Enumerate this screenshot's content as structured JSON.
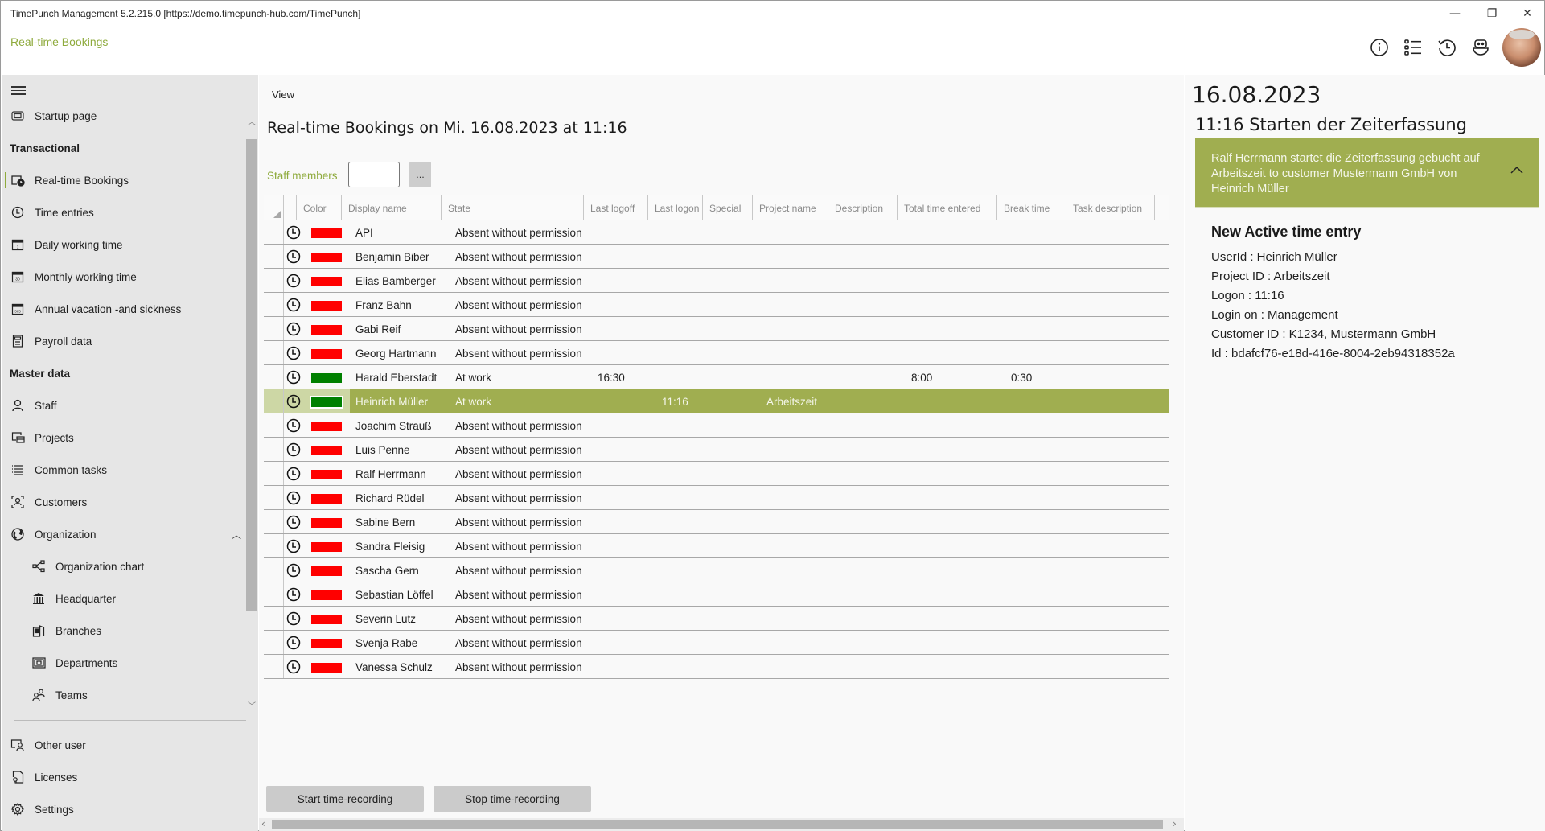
{
  "window": {
    "title": "TimePunch Management 5.2.215.0 [https://demo.timepunch-hub.com/TimePunch]",
    "controls": {
      "minimize": "—",
      "restore": "❐",
      "close": "✕"
    }
  },
  "header": {
    "breadcrumb": "Real-time Bookings",
    "icons": [
      "info-icon",
      "list-icon",
      "history-icon",
      "bot-icon"
    ],
    "avatar": "user-avatar"
  },
  "sidebar": {
    "items": [
      {
        "id": "startup",
        "label": "Startup page",
        "icon": "startup-icon"
      },
      {
        "id": "section-transactional",
        "label": "Transactional",
        "section": true
      },
      {
        "id": "realtime",
        "label": "Real-time Bookings",
        "icon": "realtime-icon",
        "active": true
      },
      {
        "id": "time-entries",
        "label": "Time entries",
        "icon": "clock-icon"
      },
      {
        "id": "daily",
        "label": "Daily working time",
        "icon": "calendar-day-icon"
      },
      {
        "id": "monthly",
        "label": "Monthly working time",
        "icon": "calendar-month-icon"
      },
      {
        "id": "annual",
        "label": "Annual vacation -and sickness",
        "icon": "calendar-year-icon"
      },
      {
        "id": "payroll",
        "label": "Payroll data",
        "icon": "calculator-icon"
      },
      {
        "id": "section-master",
        "label": "Master data",
        "section": true
      },
      {
        "id": "staff",
        "label": "Staff",
        "icon": "person-icon"
      },
      {
        "id": "projects",
        "label": "Projects",
        "icon": "projects-icon"
      },
      {
        "id": "tasks",
        "label": "Common tasks",
        "icon": "list-icon"
      },
      {
        "id": "customers",
        "label": "Customers",
        "icon": "customer-icon"
      },
      {
        "id": "organization",
        "label": "Organization",
        "icon": "globe-icon",
        "expanded": true
      },
      {
        "id": "orgchart",
        "label": "Organization chart",
        "icon": "orgchart-icon",
        "sub": true
      },
      {
        "id": "hq",
        "label": "Headquarter",
        "icon": "bank-icon",
        "sub": true
      },
      {
        "id": "branches",
        "label": "Branches",
        "icon": "building-icon",
        "sub": true
      },
      {
        "id": "departments",
        "label": "Departments",
        "icon": "department-icon",
        "sub": true
      },
      {
        "id": "teams",
        "label": "Teams",
        "icon": "team-icon",
        "sub": true
      }
    ],
    "footer": [
      {
        "id": "other-user",
        "label": "Other user",
        "icon": "switch-user-icon"
      },
      {
        "id": "licenses",
        "label": "Licenses",
        "icon": "license-icon"
      },
      {
        "id": "settings",
        "label": "Settings",
        "icon": "gear-icon"
      }
    ]
  },
  "main": {
    "view_label": "View",
    "title": "Real-time Bookings on Mi. 16.08.2023 at 11:16",
    "filter": {
      "label": "Staff members",
      "value": "",
      "browse_label": "..."
    },
    "columns": [
      "Color",
      "Display name",
      "State",
      "Last logoff",
      "Last logon",
      "Special",
      "Project name",
      "Description",
      "Total time entered",
      "Break time",
      "Task description"
    ],
    "status_colors": {
      "absent": "#ff0000",
      "at_work": "#008000"
    },
    "rows": [
      {
        "color": "absent",
        "name": "API",
        "state": "Absent without permission",
        "last_logoff": "",
        "last_logon": "",
        "special": "",
        "project": "",
        "description": "",
        "total": "",
        "break": "",
        "task": ""
      },
      {
        "color": "absent",
        "name": "Benjamin Biber",
        "state": "Absent without permission",
        "last_logoff": "",
        "last_logon": "",
        "special": "",
        "project": "",
        "description": "",
        "total": "",
        "break": "",
        "task": ""
      },
      {
        "color": "absent",
        "name": "Elias Bamberger",
        "state": "Absent without permission",
        "last_logoff": "",
        "last_logon": "",
        "special": "",
        "project": "",
        "description": "",
        "total": "",
        "break": "",
        "task": ""
      },
      {
        "color": "absent",
        "name": "Franz Bahn",
        "state": "Absent without permission",
        "last_logoff": "",
        "last_logon": "",
        "special": "",
        "project": "",
        "description": "",
        "total": "",
        "break": "",
        "task": ""
      },
      {
        "color": "absent",
        "name": "Gabi Reif",
        "state": "Absent without permission",
        "last_logoff": "",
        "last_logon": "",
        "special": "",
        "project": "",
        "description": "",
        "total": "",
        "break": "",
        "task": ""
      },
      {
        "color": "absent",
        "name": "Georg Hartmann",
        "state": "Absent without permission",
        "last_logoff": "",
        "last_logon": "",
        "special": "",
        "project": "",
        "description": "",
        "total": "",
        "break": "",
        "task": ""
      },
      {
        "color": "at_work",
        "name": "Harald Eberstadt",
        "state": "At work",
        "last_logoff": "16:30",
        "last_logon": "",
        "special": "",
        "project": "",
        "description": "",
        "total": "8:00",
        "break": "0:30",
        "task": ""
      },
      {
        "color": "at_work",
        "name": "Heinrich  Müller",
        "state": "At work",
        "last_logoff": "",
        "last_logon": "11:16",
        "special": "",
        "project": "Arbeitszeit",
        "description": "",
        "total": "",
        "break": "",
        "task": "",
        "selected": true
      },
      {
        "color": "absent",
        "name": "Joachim Strauß",
        "state": "Absent without permission",
        "last_logoff": "",
        "last_logon": "",
        "special": "",
        "project": "",
        "description": "",
        "total": "",
        "break": "",
        "task": ""
      },
      {
        "color": "absent",
        "name": "Luis Penne",
        "state": "Absent without permission",
        "last_logoff": "",
        "last_logon": "",
        "special": "",
        "project": "",
        "description": "",
        "total": "",
        "break": "",
        "task": ""
      },
      {
        "color": "absent",
        "name": "Ralf Herrmann",
        "state": "Absent without permission",
        "last_logoff": "",
        "last_logon": "",
        "special": "",
        "project": "",
        "description": "",
        "total": "",
        "break": "",
        "task": ""
      },
      {
        "color": "absent",
        "name": "Richard Rüdel",
        "state": "Absent without permission",
        "last_logoff": "",
        "last_logon": "",
        "special": "",
        "project": "",
        "description": "",
        "total": "",
        "break": "",
        "task": ""
      },
      {
        "color": "absent",
        "name": "Sabine Bern",
        "state": "Absent without permission",
        "last_logoff": "",
        "last_logon": "",
        "special": "",
        "project": "",
        "description": "",
        "total": "",
        "break": "",
        "task": ""
      },
      {
        "color": "absent",
        "name": "Sandra Fleisig",
        "state": "Absent without permission",
        "last_logoff": "",
        "last_logon": "",
        "special": "",
        "project": "",
        "description": "",
        "total": "",
        "break": "",
        "task": ""
      },
      {
        "color": "absent",
        "name": "Sascha Gern",
        "state": "Absent without permission",
        "last_logoff": "",
        "last_logon": "",
        "special": "",
        "project": "",
        "description": "",
        "total": "",
        "break": "",
        "task": ""
      },
      {
        "color": "absent",
        "name": "Sebastian Löffel",
        "state": "Absent without permission",
        "last_logoff": "",
        "last_logon": "",
        "special": "",
        "project": "",
        "description": "",
        "total": "",
        "break": "",
        "task": ""
      },
      {
        "color": "absent",
        "name": "Severin Lutz",
        "state": "Absent without permission",
        "last_logoff": "",
        "last_logon": "",
        "special": "",
        "project": "",
        "description": "",
        "total": "",
        "break": "",
        "task": ""
      },
      {
        "color": "absent",
        "name": "Svenja Rabe",
        "state": "Absent without permission",
        "last_logoff": "",
        "last_logon": "",
        "special": "",
        "project": "",
        "description": "",
        "total": "",
        "break": "",
        "task": ""
      },
      {
        "color": "absent",
        "name": "Vanessa Schulz",
        "state": "Absent without permission",
        "last_logoff": "",
        "last_logon": "",
        "special": "",
        "project": "",
        "description": "",
        "total": "",
        "break": "",
        "task": ""
      }
    ],
    "buttons": {
      "start": "Start time-recording",
      "stop": "Stop time-recording"
    }
  },
  "detail": {
    "date": "16.08.2023",
    "event_title": "11:16 Starten der Zeiterfassung",
    "event_message": "Ralf Herrmann startet die Zeiterfassung gebucht auf Arbeitszeit to customer Mustermann GmbH von Heinrich Müller",
    "section_title": "New Active time entry",
    "lines": [
      "UserId : Heinrich Müller",
      "Project ID : Arbeitszeit",
      "Logon : 11:16",
      "Login on : Management",
      "Customer ID : K1234, Mustermann GmbH",
      "Id : bdafcf76-e18d-416e-8004-2eb94318352a"
    ]
  },
  "theme": {
    "accent": "#8eaa3c",
    "selection": "#a0ae50"
  }
}
